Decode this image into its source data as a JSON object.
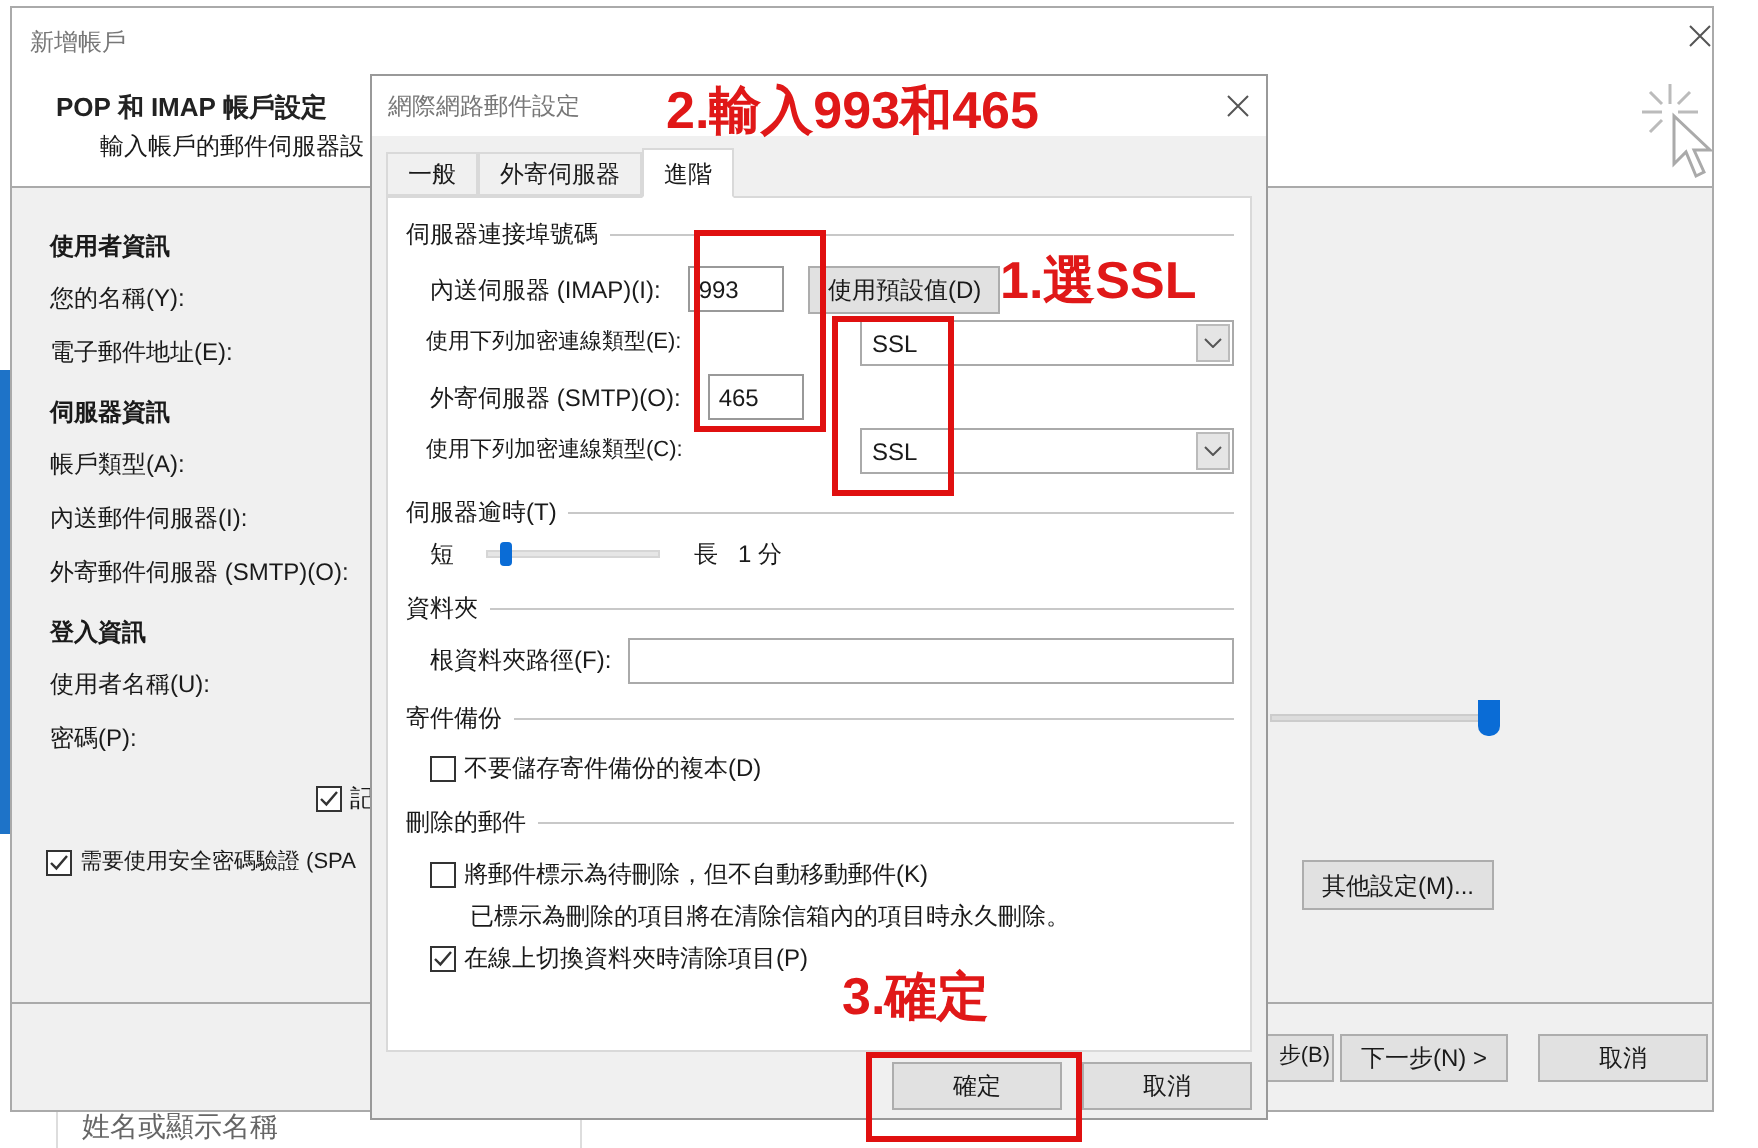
{
  "background": {
    "column_label": "姓名或顯示名稱"
  },
  "account_window": {
    "title": "新增帳戶",
    "header_title": "POP 和 IMAP 帳戶設定",
    "header_subtitle": "輸入帳戶的郵件伺服器設",
    "sections": [
      {
        "heading": "使用者資訊",
        "fields": [
          "您的名稱(Y):",
          "電子郵件地址(E):"
        ]
      },
      {
        "heading": "伺服器資訊",
        "fields": [
          "帳戶類型(A):",
          "內送郵件伺服器(I):",
          "外寄郵件伺服器 (SMTP)(O):"
        ]
      },
      {
        "heading": "登入資訊",
        "fields": [
          "使用者名稱(U):",
          "密碼(P):"
        ]
      }
    ],
    "remember_password": {
      "label": "記",
      "checked": true
    },
    "spa": {
      "label": "需要使用安全密碼驗證 (SPA",
      "checked": true
    },
    "slider": {
      "level": 1
    },
    "more_settings_button": "其他設定(M)...",
    "buttons": [
      "步(B)",
      "下一步(N) >",
      "取消"
    ]
  },
  "dialog": {
    "title": "網際網路郵件設定",
    "tabs": [
      {
        "label": "一般",
        "selected": false
      },
      {
        "label": "外寄伺服器",
        "selected": false
      },
      {
        "label": "進階",
        "selected": true
      }
    ],
    "ports": {
      "heading": "伺服器連接埠號碼",
      "incoming": {
        "label": "內送伺服器 (IMAP)(I):",
        "value": "993"
      },
      "default_button": "使用預設值(D)",
      "incoming_encryption": {
        "label": "使用下列加密連線類型(E):",
        "value": "SSL"
      },
      "outgoing": {
        "label": "外寄伺服器 (SMTP)(O):",
        "value": "465"
      },
      "outgoing_encryption": {
        "label": "使用下列加密連線類型(C):",
        "value": "SSL"
      }
    },
    "timeout": {
      "heading": "伺服器逾時(T)",
      "min_label": "短",
      "max_label": "長",
      "level": 0.1,
      "reading": "1 分"
    },
    "folders": {
      "heading": "資料夾",
      "root_label": "根資料夾路徑(F):"
    },
    "sent_items": {
      "heading": "寄件備份",
      "options": [
        {
          "kind": "checkbox",
          "label": "不要儲存寄件備份的複本(D)",
          "checked": false
        }
      ]
    },
    "deleted_items": {
      "heading": "刪除的郵件",
      "options": [
        {
          "kind": "checkbox",
          "label": "將郵件標示為待刪除，但不自動移動郵件(K)",
          "checked": false
        },
        {
          "kind": "note",
          "label": "已標示為刪除的項目將在清除信箱內的項目時永久刪除。"
        },
        {
          "kind": "checkbox",
          "label": "在線上切換資料夾時清除項目(P)",
          "checked": true
        }
      ]
    },
    "buttons": [
      "確定",
      "取消"
    ]
  },
  "annotations": [
    {
      "text": "2.輸入993和465"
    },
    {
      "text": "1.選SSL"
    },
    {
      "text": "3.確定"
    }
  ]
}
